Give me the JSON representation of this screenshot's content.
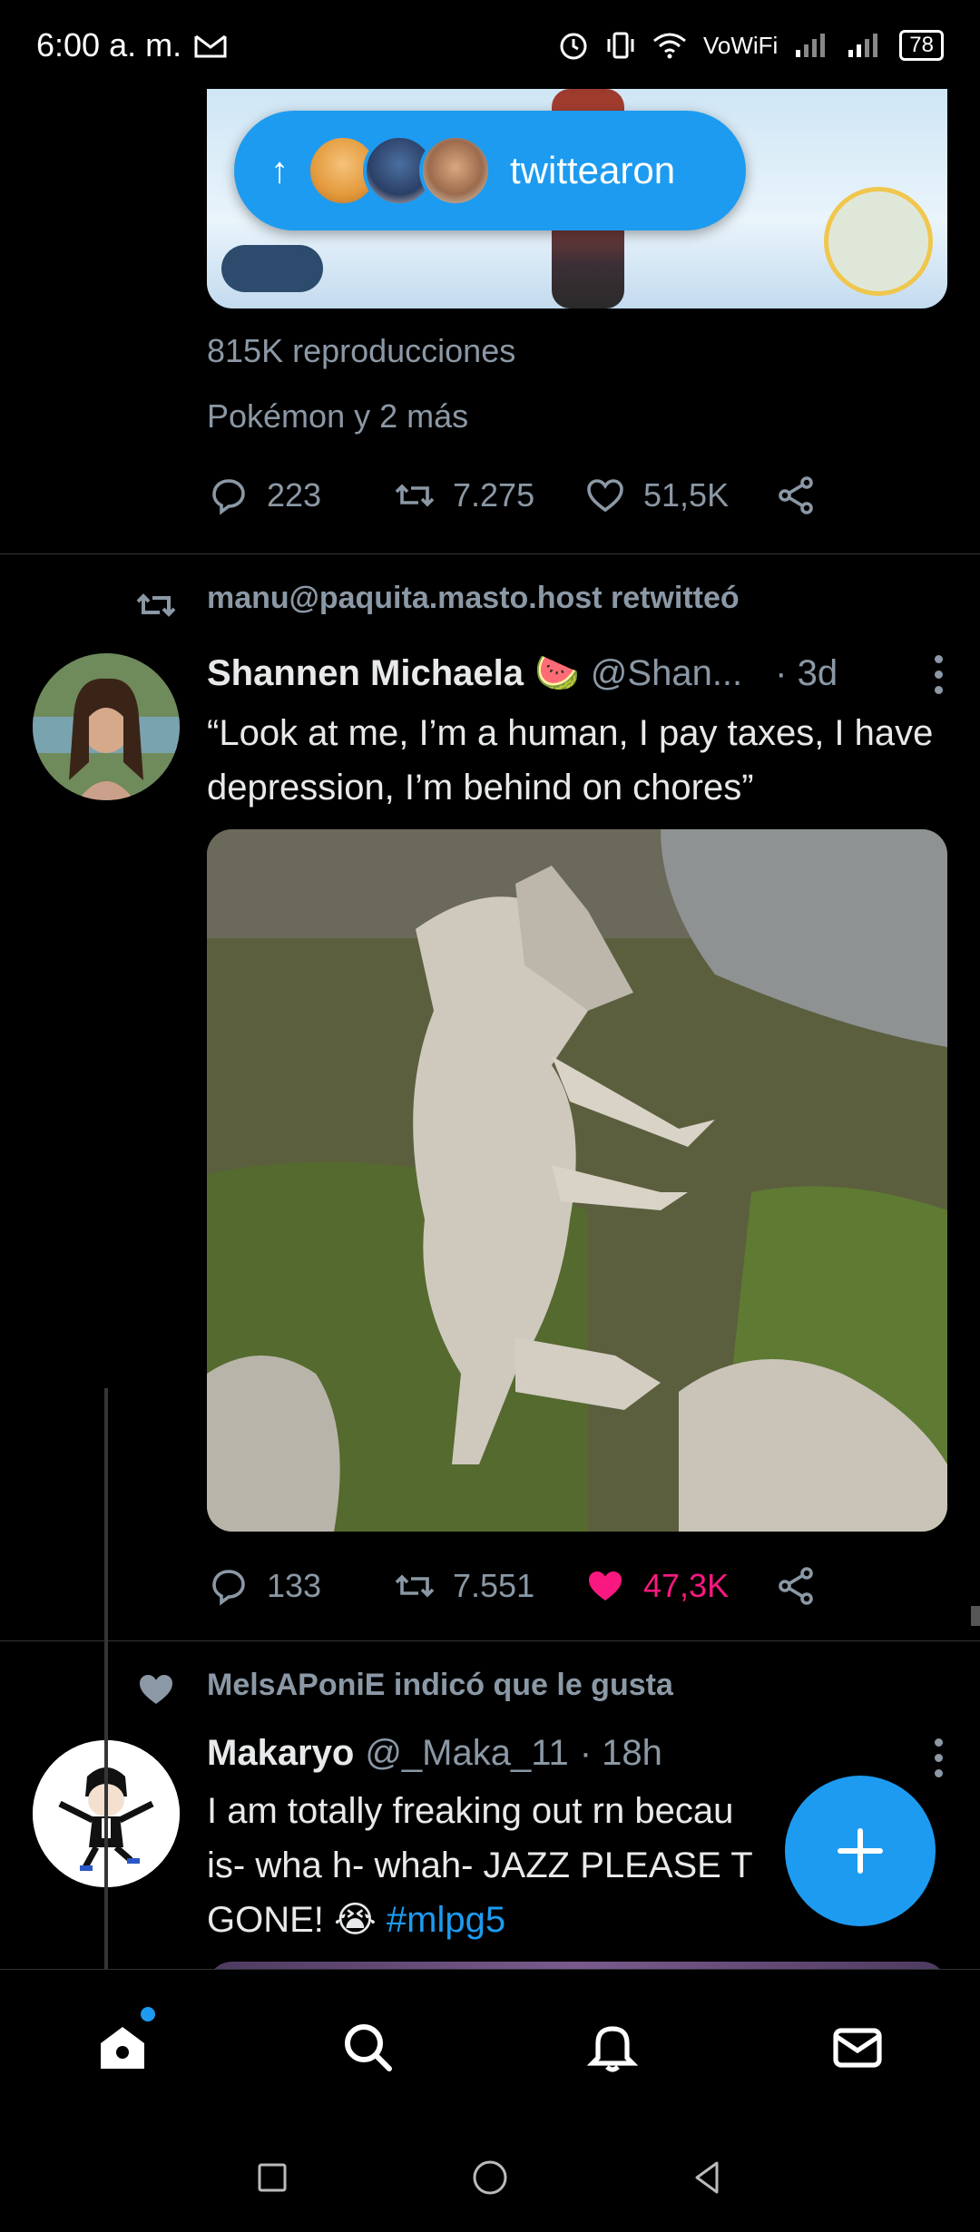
{
  "status_bar": {
    "time": "6:00 a. m.",
    "network_label": "VoWiFi",
    "battery": "78"
  },
  "tweet1": {
    "retweeted_by_label": "twittearon",
    "views": "815K reproducciones",
    "tags": "Pokémon y 2 más",
    "replies": "223",
    "retweets": "7.275",
    "likes": "51,5K"
  },
  "tweet2": {
    "social_context": "manu@paquita.masto.host retwitteó",
    "name": "Shannen Michaela",
    "emoji": "🍉",
    "handle": "@Shan...",
    "time": "· 3d",
    "text": "“Look at me, I’m a human, I pay taxes, I have depression, I’m behind on chores”",
    "replies": "133",
    "retweets": "7.551",
    "likes": "47,3K",
    "liked": true
  },
  "tweet3": {
    "social_context": "MelsAPoniE indicó que le gusta",
    "name": "Makaryo",
    "handle": "@_Maka_11",
    "time": "· 18h",
    "text": "I am totally freaking out rn becau... is- wha h- whah- JAZZ PLEASE T... GONE! 😭",
    "text_line1": "I am totally freaking out rn becau",
    "text_line2": "is- wha h- whah- JAZZ PLEASE T",
    "text_line3": "GONE! 😭",
    "hashtag": "#mlpg5"
  },
  "colors": {
    "accent": "#1d9bf0",
    "like_active": "#f91880",
    "muted": "#8b98a5",
    "background": "#000000"
  },
  "icons": [
    "reply-icon",
    "retweet-icon",
    "like-icon",
    "share-icon",
    "home-icon",
    "search-icon",
    "bell-icon",
    "mail-icon",
    "compose-plus-icon"
  ]
}
